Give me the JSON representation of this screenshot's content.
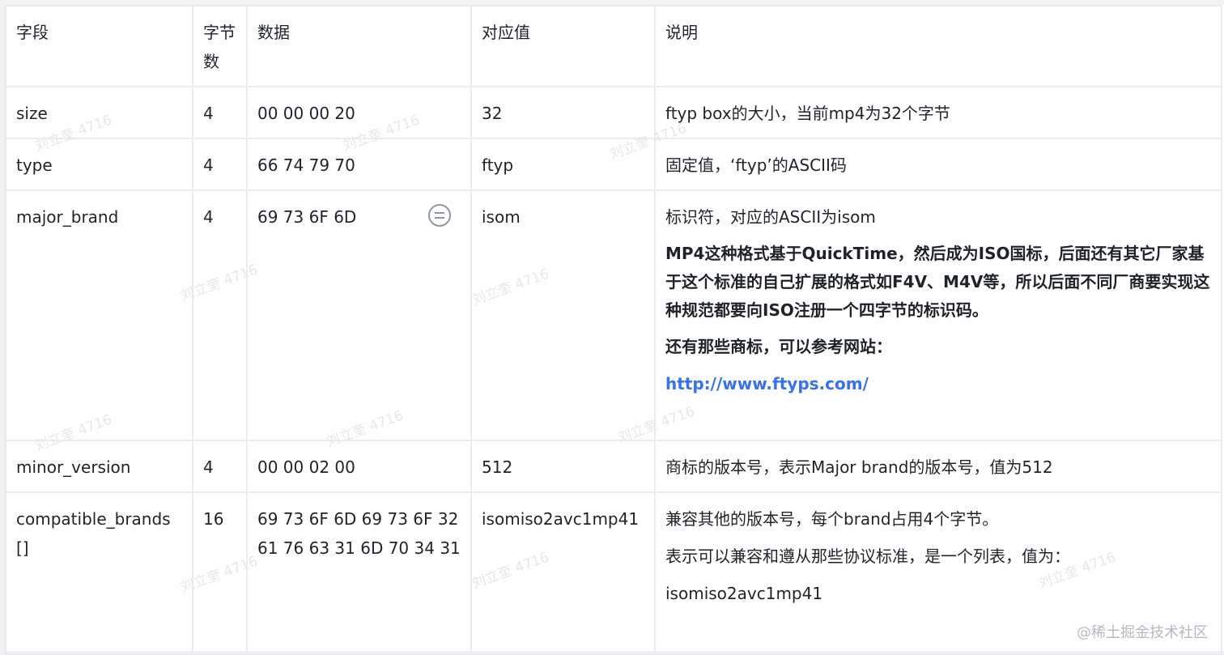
{
  "table": {
    "headers": [
      "字段",
      "字节数",
      "数据",
      "对应值",
      "说明"
    ],
    "rows": {
      "size": {
        "field": "size",
        "bytes": "4",
        "data": "00 00 00 20",
        "value": "32",
        "desc": [
          "ftyp box的大小，当前mp4为32个字节"
        ]
      },
      "type": {
        "field": "type",
        "bytes": "4",
        "data": "66 74 79 70",
        "value": "ftyp",
        "desc": [
          "固定值，‘ftyp’的ASCII码"
        ]
      },
      "major_brand": {
        "field": "major_brand",
        "bytes": "4",
        "data": "69 73 6F 6D",
        "value": "isom",
        "desc_plain": "标识符，对应的ASCII为isom",
        "desc_bold": "MP4这种格式基于QuickTime，然后成为ISO国标，后面还有其它厂家基于这个标准的自己扩展的格式如F4V、M4V等，所以后面不同厂商要实现这种规范都要向ISO注册一个四字节的标识码。",
        "desc_bold2": "还有那些商标，可以参考网站：",
        "link": "http://www.ftyps.com/"
      },
      "minor_version": {
        "field": "minor_version",
        "bytes": "4",
        "data": "00 00 02 00",
        "value": "512",
        "desc": [
          "商标的版本号，表示Major brand的版本号，值为512"
        ]
      },
      "compatible_brands": {
        "field": "compatible_brands[]",
        "bytes": "16",
        "data": "69 73 6F 6D 69 73 6F 32 61 76 63 31 6D 70 34 31",
        "value": "isomiso2avc1mp41",
        "desc": [
          "兼容其他的版本号，每个brand占用4个字节。",
          "表示可以兼容和遵从那些协议标准，是一个列表，值为：",
          "isomiso2avc1mp41"
        ]
      }
    }
  },
  "watermark": {
    "text": "刘立奎 4716",
    "site": "@稀土掘金技术社区"
  },
  "icons": {
    "data_cell_action": "equal-circle-icon"
  },
  "colors": {
    "link": "#3370ff",
    "border": "#e9ebee",
    "text": "#1f2329"
  }
}
